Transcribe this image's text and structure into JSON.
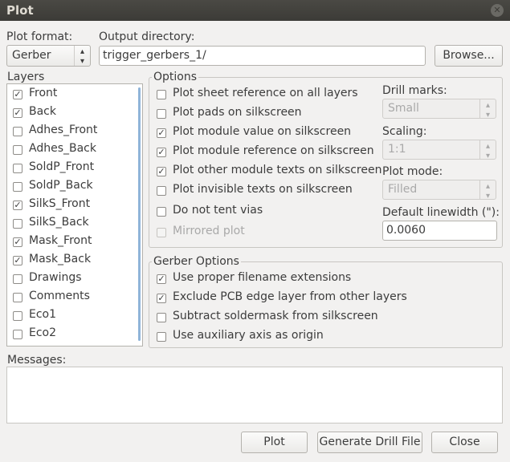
{
  "window": {
    "title": "Plot"
  },
  "plot_format": {
    "label": "Plot format:",
    "value": "Gerber"
  },
  "output_dir": {
    "label": "Output directory:",
    "value": "trigger_gerbers_1/",
    "browse_label": "Browse..."
  },
  "layers": {
    "title": "Layers",
    "items": [
      {
        "label": "Front",
        "checked": true
      },
      {
        "label": "Back",
        "checked": true
      },
      {
        "label": "Adhes_Front",
        "checked": false
      },
      {
        "label": "Adhes_Back",
        "checked": false
      },
      {
        "label": "SoldP_Front",
        "checked": false
      },
      {
        "label": "SoldP_Back",
        "checked": false
      },
      {
        "label": "SilkS_Front",
        "checked": true
      },
      {
        "label": "SilkS_Back",
        "checked": false
      },
      {
        "label": "Mask_Front",
        "checked": true
      },
      {
        "label": "Mask_Back",
        "checked": true
      },
      {
        "label": "Drawings",
        "checked": false
      },
      {
        "label": "Comments",
        "checked": false
      },
      {
        "label": "Eco1",
        "checked": false
      },
      {
        "label": "Eco2",
        "checked": false
      }
    ]
  },
  "options": {
    "title": "Options",
    "items": [
      {
        "label": "Plot sheet reference on all layers",
        "checked": false,
        "enabled": true
      },
      {
        "label": "Plot pads on silkscreen",
        "checked": false,
        "enabled": true
      },
      {
        "label": "Plot module value on silkscreen",
        "checked": true,
        "enabled": true
      },
      {
        "label": "Plot module reference on silkscreen",
        "checked": true,
        "enabled": true
      },
      {
        "label": "Plot other module texts on silkscreen",
        "checked": true,
        "enabled": true
      },
      {
        "label": "Plot invisible texts on silkscreen",
        "checked": false,
        "enabled": true
      },
      {
        "label": "Do not tent vias",
        "checked": false,
        "enabled": true
      },
      {
        "label": "Mirrored plot",
        "checked": false,
        "enabled": false
      }
    ],
    "drill_marks": {
      "label": "Drill marks:",
      "value": "Small"
    },
    "scaling": {
      "label": "Scaling:",
      "value": "1:1"
    },
    "plot_mode": {
      "label": "Plot mode:",
      "value": "Filled"
    },
    "default_linewidth": {
      "label": "Default linewidth (\"):",
      "value": "0.0060"
    }
  },
  "gerber_options": {
    "title": "Gerber Options",
    "items": [
      {
        "label": "Use proper filename extensions",
        "checked": true
      },
      {
        "label": "Exclude PCB edge layer from other layers",
        "checked": true
      },
      {
        "label": "Subtract soldermask from silkscreen",
        "checked": false
      },
      {
        "label": "Use auxiliary axis as origin",
        "checked": false
      }
    ]
  },
  "messages": {
    "label": "Messages:",
    "value": ""
  },
  "buttons": {
    "plot": "Plot",
    "drill": "Generate Drill File",
    "close": "Close"
  },
  "icons": {
    "close": "close-icon",
    "spin": "updown-arrows-icon",
    "check": "checkmark-icon"
  }
}
